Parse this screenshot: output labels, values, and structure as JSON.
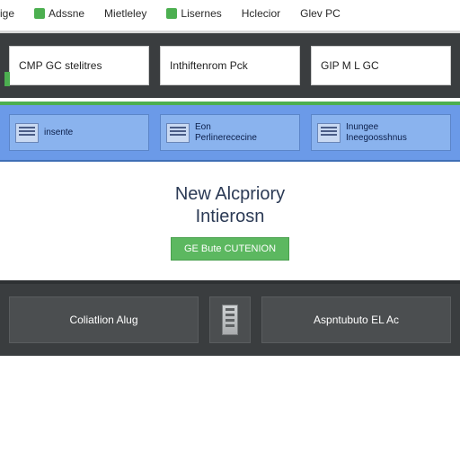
{
  "nav": {
    "items": [
      {
        "label": "ige"
      },
      {
        "label": "Adssne",
        "badge": true
      },
      {
        "label": "Mietleley"
      },
      {
        "label": "Lisernes",
        "badge": true
      },
      {
        "label": "Hclecior"
      },
      {
        "label": "Glev PC"
      }
    ]
  },
  "top_panels": [
    {
      "label": "CMP GC stelitres"
    },
    {
      "label": "Inthiftenrom Pck"
    },
    {
      "label": "GIP M L GC"
    }
  ],
  "blue_cards": [
    {
      "line1": "",
      "line2": "insente"
    },
    {
      "line1": "Eon",
      "line2": "Perlinerececine"
    },
    {
      "line1": "Inungee",
      "line2": "Ineegoosshnus"
    }
  ],
  "center": {
    "headline_line1": "New Alcpriory",
    "headline_line2": "Intierosn",
    "button": "GE Bute CUTENION"
  },
  "bottom_panels": [
    {
      "label": "Coliatlion Alug"
    },
    {
      "label": "Aspntubuto EL Ac"
    }
  ]
}
